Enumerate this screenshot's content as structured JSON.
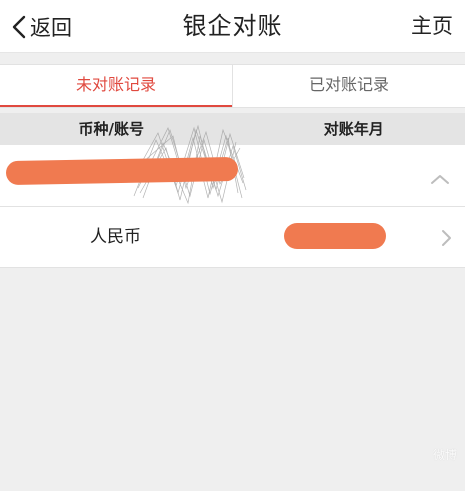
{
  "navbar": {
    "back_label": "返回",
    "title": "银企对账",
    "home_label": "主页"
  },
  "tabs": [
    {
      "label": "未对账记录",
      "active": true
    },
    {
      "label": "已对账记录",
      "active": false
    }
  ],
  "table_header": {
    "col_account": "币种/账号",
    "col_period": "对账年月"
  },
  "account_group": {
    "account_number": "",
    "expanded": true
  },
  "rows": [
    {
      "currency": "人民币",
      "period": ""
    }
  ],
  "colors": {
    "accent": "#e0493f",
    "redaction": "#f07a50",
    "background": "#efefef"
  },
  "watermark": {
    "logo": "微博"
  }
}
